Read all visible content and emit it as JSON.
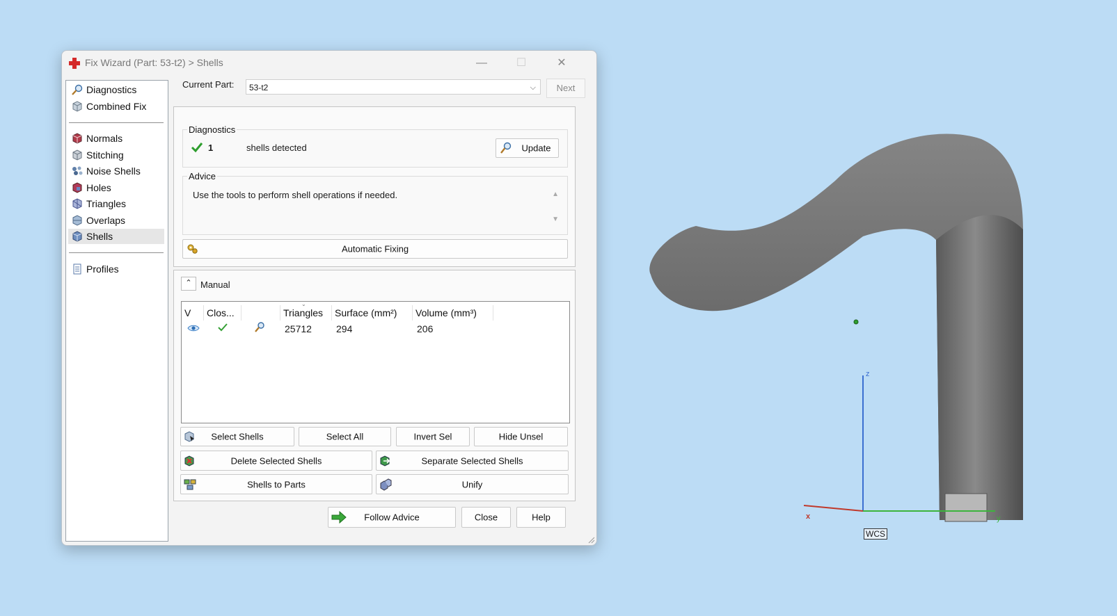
{
  "window": {
    "title": "Fix Wizard (Part: 53-t2) > Shells",
    "minimize": "—",
    "maximize": "☐",
    "close": "✕"
  },
  "nav": {
    "items": [
      {
        "label": "Diagnostics",
        "icon": "magnifier-icon"
      },
      {
        "label": "Combined Fix",
        "icon": "cube-icon"
      },
      {
        "label": "Normals",
        "icon": "normals-cube-icon"
      },
      {
        "label": "Stitching",
        "icon": "stitching-cube-icon"
      },
      {
        "label": "Noise Shells",
        "icon": "noise-shells-icon"
      },
      {
        "label": "Holes",
        "icon": "holes-cube-icon"
      },
      {
        "label": "Triangles",
        "icon": "triangles-cube-icon"
      },
      {
        "label": "Overlaps",
        "icon": "overlaps-cube-icon"
      },
      {
        "label": "Shells",
        "icon": "shells-cube-icon"
      },
      {
        "label": "Profiles",
        "icon": "document-icon"
      }
    ],
    "active": "Shells"
  },
  "current_part": {
    "label": "Current Part:",
    "value": "53-t2",
    "next_label": "Next"
  },
  "diagnostics": {
    "title": "Diagnostics",
    "count": "1",
    "status_text": "shells detected",
    "update_label": "Update"
  },
  "advice": {
    "title": "Advice",
    "text": "Use the tools to perform shell operations if needed.",
    "auto_fix_label": "Automatic Fixing"
  },
  "manual": {
    "title": "Manual",
    "columns": [
      "V",
      "Clos...",
      "",
      "Triangles",
      "Surface (mm²)",
      "Volume (mm³)"
    ],
    "rows": [
      {
        "triangles": "25712",
        "surface": "294",
        "volume": "206"
      }
    ],
    "buttons": {
      "select_shells": "Select Shells",
      "select_all": "Select All",
      "invert_sel": "Invert Sel",
      "hide_unsel": "Hide Unsel",
      "delete_selected": "Delete Selected Shells",
      "separate_selected": "Separate Selected Shells",
      "shells_to_parts": "Shells to Parts",
      "unify": "Unify"
    }
  },
  "footer": {
    "follow_advice": "Follow Advice",
    "close": "Close",
    "help": "Help"
  },
  "viewport": {
    "axis_z": "z",
    "axis_x": "x",
    "axis_y": "y",
    "wcs": "WCS"
  },
  "colors": {
    "desktop": "#bcdcf5",
    "check_green": "#2e9e2e",
    "axis_x": "#c0392b",
    "axis_y": "#3cb43c",
    "axis_z": "#3b6fd1",
    "mesh_gray": "#6b6b6b"
  }
}
